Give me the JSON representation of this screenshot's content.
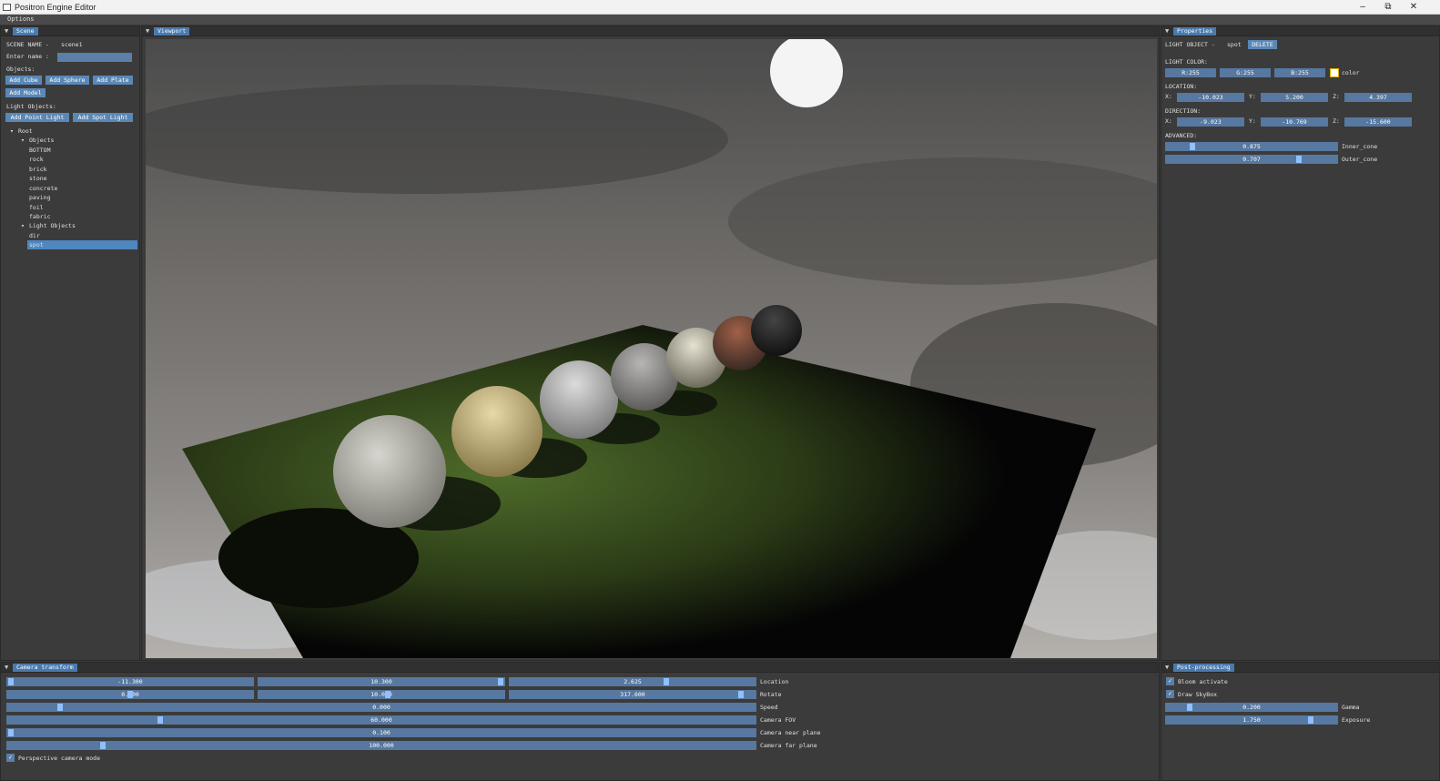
{
  "window": {
    "title": "Positron Engine Editor",
    "minimize": "–",
    "maximize": "⧉",
    "close": "✕"
  },
  "menu": {
    "options": "Options"
  },
  "scene_panel": {
    "tab": "Scene",
    "scene_name_label": "SCENE NAME -",
    "scene_name_value": "scene1",
    "enter_name_label": "Enter name :",
    "objects_label": "Objects:",
    "add_cube": "Add Cube",
    "add_sphere": "Add Sphere",
    "add_plate": "Add Plate",
    "add_model": "Add Model",
    "light_objects_label": "Light Objects:",
    "add_point_light": "Add Point Light",
    "add_spot_light": "Add Spot Light",
    "tree": {
      "root": "Root",
      "objects": "Objects",
      "object_items": [
        "BOTTOM",
        "rock",
        "brick",
        "stone",
        "concrete",
        "paving",
        "foil",
        "fabric"
      ],
      "light_objects": "Light Objects",
      "light_items": [
        "dir",
        "spot"
      ],
      "selected": "spot"
    }
  },
  "viewport_panel": {
    "tab": "Viewport"
  },
  "properties_panel": {
    "tab": "Properties",
    "light_object_label": "LIGHT OBJECT -",
    "light_object_name": "spot",
    "delete": "DELETE",
    "light_color_label": "LIGHT COLOR:",
    "r": "R:255",
    "g": "G:255",
    "b": "B:255",
    "color_label": "color",
    "location_label": "LOCATION:",
    "loc": {
      "x_label": "X:",
      "x": "-10.023",
      "y_label": "Y:",
      "y": "5.200",
      "z_label": "Z:",
      "z": "4.397"
    },
    "direction_label": "DIRECTION:",
    "dir": {
      "x_label": "X:",
      "x": "-9.023",
      "y_label": "Y:",
      "y": "-10.769",
      "z_label": "Z:",
      "z": "-15.600"
    },
    "advanced_label": "ADVANCED:",
    "inner_cone": {
      "value": "0.875",
      "label": "Inner_cone",
      "fraction": 0.14
    },
    "outer_cone": {
      "value": "0.707",
      "label": "Outer_cone",
      "fraction": 0.78
    }
  },
  "camera_panel": {
    "tab": "Camera transform",
    "location": {
      "label": "Location",
      "values": [
        "-11.300",
        "10.300",
        "2.625"
      ]
    },
    "rotate": {
      "label": "Rotate",
      "values": [
        "0.000",
        "10.000",
        "317.600"
      ]
    },
    "speed": {
      "label": "Speed",
      "value": "0.000"
    },
    "fov": {
      "label": "Camera FOV",
      "value": "60.000"
    },
    "near": {
      "label": "Camera near plane",
      "value": "0.100"
    },
    "far": {
      "label": "Camera far plane",
      "value": "100.000"
    },
    "perspective": {
      "label": "Perspective camera mode",
      "checked": true
    }
  },
  "post_panel": {
    "tab": "Post-processing",
    "bloom": {
      "label": "Bloom activate",
      "checked": true
    },
    "skybox": {
      "label": "Draw SkyBox",
      "checked": true
    },
    "gamma": {
      "label": "Gamma",
      "value": "0.200",
      "fraction": 0.12
    },
    "exposure": {
      "label": "Exposure",
      "value": "1.750",
      "fraction": 0.85
    }
  },
  "colors": {
    "accent": "#4a7aad",
    "panel": "#3b3b3b",
    "field": "#5778a0",
    "grab": "#8fc0ff"
  },
  "icons": {
    "pin": "pin-icon",
    "tree_open": "tree-open-icon",
    "check": "check-icon",
    "color_swatch": "color-swatch-icon"
  }
}
